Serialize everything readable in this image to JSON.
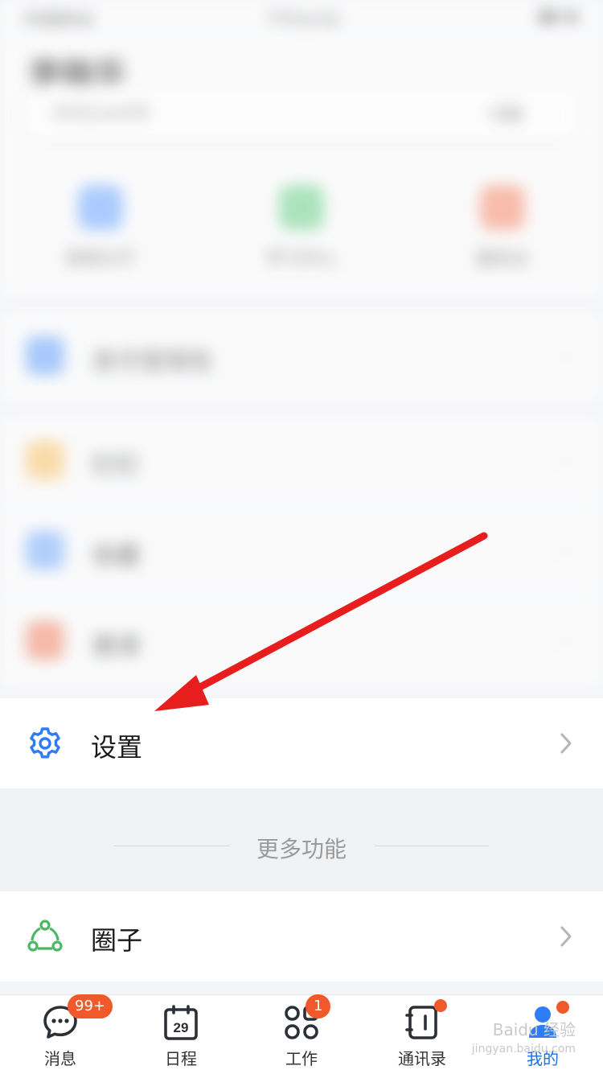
{
  "status_bar": {
    "carrier": "中国移动",
    "time": "下午4:52",
    "battery": ""
  },
  "header": {
    "user_name": "李晓华",
    "org_name": "测试企业名称",
    "org_switch": "切换"
  },
  "quick_actions": [
    {
      "label": "视频大厅",
      "color": "#6aa6ff"
    },
    {
      "label": "学习中心",
      "color": "#6bd089"
    },
    {
      "label": "服务台",
      "color": "#f68a6a"
    }
  ],
  "blurred_rows": [
    {
      "label": "支付宝钱包",
      "color": "#6aa6ff"
    },
    {
      "label": "钉钉",
      "color": "#ffc86a"
    },
    {
      "label": "收藏",
      "color": "#7ab0ff"
    },
    {
      "label": "邀请",
      "color": "#f68a6a"
    }
  ],
  "settings": {
    "label": "设置",
    "icon": "gear-icon",
    "color": "#2f7cf6"
  },
  "more": {
    "label": "更多功能"
  },
  "circle": {
    "label": "圈子",
    "icon": "circle-group-icon",
    "color": "#4cb764"
  },
  "tabbar": {
    "items": [
      {
        "label": "消息",
        "badge": "99+"
      },
      {
        "label": "日程",
        "date": "29"
      },
      {
        "label": "工作",
        "badge": "1"
      },
      {
        "label": "通讯录"
      },
      {
        "label": "我的"
      }
    ]
  },
  "watermark": {
    "line1": "Baidu 经验",
    "line2": "jingyan.baidu.com"
  }
}
